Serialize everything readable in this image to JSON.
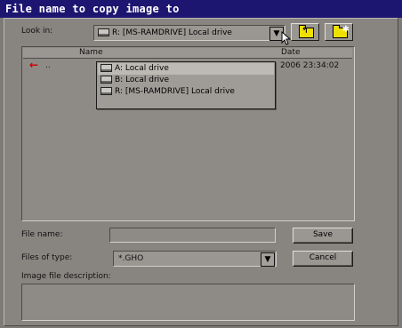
{
  "window": {
    "title": "File name to copy image to"
  },
  "look_in": {
    "label": "Look in:",
    "selected": "R: [MS-RAMDRIVE] Local drive",
    "dropdown": [
      {
        "label": "A: Local drive",
        "icon": "floppy-drive-icon"
      },
      {
        "label": "B: Local drive",
        "icon": "floppy-drive-icon"
      },
      {
        "label": "R: [MS-RAMDRIVE] Local drive",
        "icon": "ram-drive-icon"
      }
    ]
  },
  "toolbar": {
    "up_folder_icon": "up-one-level-icon",
    "new_folder_icon": "new-folder-icon"
  },
  "file_list": {
    "columns": [
      "Name",
      "Date"
    ],
    "rows": [
      {
        "name": "..",
        "date": "2006 23:34:02",
        "icon": "up-arrow-icon"
      }
    ]
  },
  "file_name": {
    "label": "File name:",
    "value": ""
  },
  "files_of_type": {
    "label": "Files of type:",
    "value": "*.GHO"
  },
  "image_description": {
    "label": "Image file description:",
    "value": ""
  },
  "buttons": {
    "save": "Save",
    "cancel": "Cancel"
  },
  "colors": {
    "titlebar": "#1d1670",
    "background": "#888581",
    "accent_red": "#cc0000"
  }
}
